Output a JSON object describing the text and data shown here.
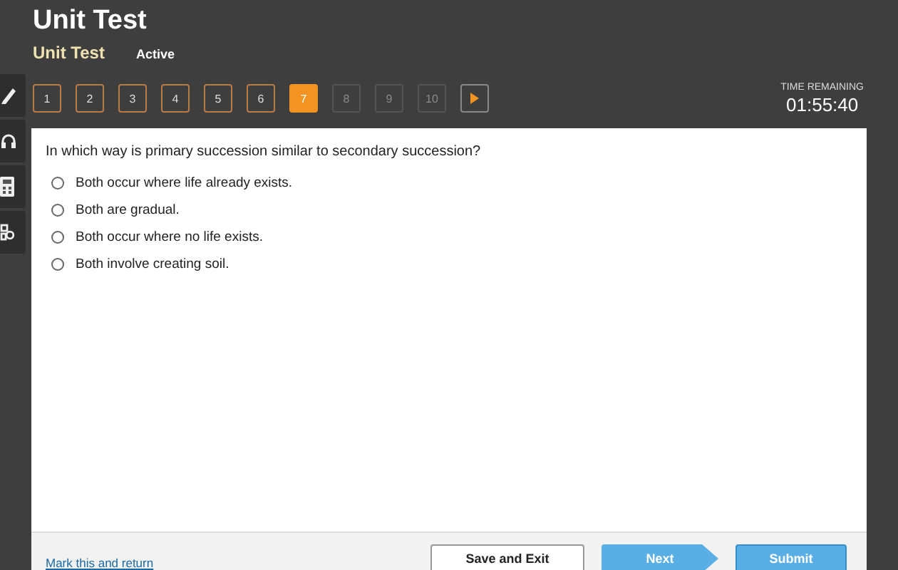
{
  "header": {
    "title": "Unit Test",
    "subtitle": "Unit Test",
    "status": "Active"
  },
  "question_nav": [
    {
      "label": "1",
      "selected": false,
      "disabled": false
    },
    {
      "label": "2",
      "selected": false,
      "disabled": false
    },
    {
      "label": "3",
      "selected": false,
      "disabled": false
    },
    {
      "label": "4",
      "selected": false,
      "disabled": false
    },
    {
      "label": "5",
      "selected": false,
      "disabled": false
    },
    {
      "label": "6",
      "selected": false,
      "disabled": false
    },
    {
      "label": "7",
      "selected": true,
      "disabled": false
    },
    {
      "label": "8",
      "selected": false,
      "disabled": true
    },
    {
      "label": "9",
      "selected": false,
      "disabled": true
    },
    {
      "label": "10",
      "selected": false,
      "disabled": true
    }
  ],
  "tools": [
    {
      "kind": "pencil"
    },
    {
      "kind": "headphones"
    },
    {
      "kind": "calculator"
    },
    {
      "kind": "grid"
    }
  ],
  "timer": {
    "label": "TIME REMAINING",
    "value": "01:55:40"
  },
  "question": {
    "prompt": "In which way is primary succession similar to secondary succession?",
    "options": [
      {
        "text": "Both occur where life already exists.",
        "selected": false
      },
      {
        "text": "Both are gradual.",
        "selected": false
      },
      {
        "text": "Both occur where no life exists.",
        "selected": false
      },
      {
        "text": "Both involve creating soil.",
        "selected": false
      }
    ]
  },
  "footer": {
    "link": "Mark this and return",
    "buttons": [
      {
        "label": "Save and Exit",
        "kind": "plain"
      },
      {
        "label": "Next",
        "kind": "arrow"
      },
      {
        "label": "Submit",
        "kind": "primary"
      }
    ]
  }
}
